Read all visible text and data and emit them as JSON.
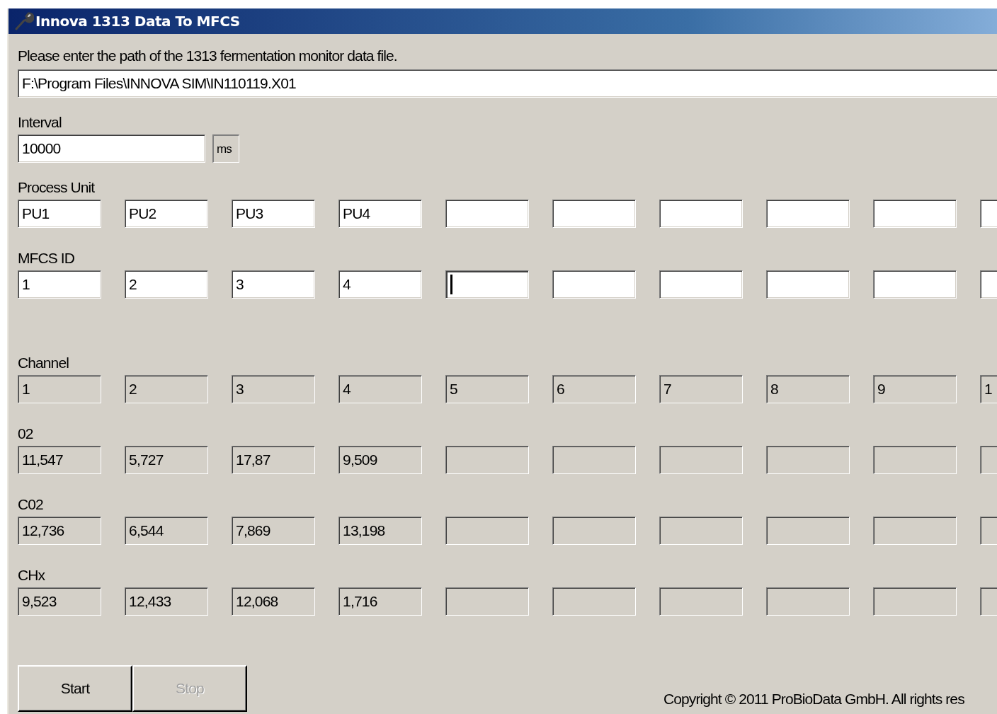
{
  "window": {
    "title": "Innova 1313 Data To MFCS"
  },
  "path": {
    "label": "Please enter the path of the 1313 fermentation monitor data file.",
    "value": "F:\\Program Files\\INNOVA SIM\\IN110119.X01"
  },
  "interval": {
    "label": "Interval",
    "value": "10000",
    "unit": "ms"
  },
  "groups": [
    {
      "rows": [
        {
          "label": "Process Unit",
          "readonly": false,
          "cells": [
            {
              "value": "PU1",
              "focused": false
            },
            {
              "value": "PU2",
              "focused": false
            },
            {
              "value": "PU3",
              "focused": false
            },
            {
              "value": "PU4",
              "focused": false
            },
            {
              "focused": false
            },
            {
              "focused": false
            },
            {
              "focused": false
            },
            {
              "focused": false
            },
            {
              "focused": false
            },
            {
              "focused": false
            }
          ]
        },
        {
          "label": "MFCS ID",
          "readonly": false,
          "cells": [
            {
              "value": "1",
              "focused": false
            },
            {
              "value": "2",
              "focused": false
            },
            {
              "value": "3",
              "focused": false
            },
            {
              "value": "4",
              "focused": false
            },
            {
              "focused": true
            },
            {
              "focused": false
            },
            {
              "focused": false
            },
            {
              "focused": false
            },
            {
              "focused": false
            },
            {
              "focused": false
            }
          ]
        }
      ]
    },
    {
      "rows": [
        {
          "label": "Channel",
          "readonly": true,
          "cells": [
            {
              "value": "1",
              "focused": false
            },
            {
              "value": "2",
              "focused": false
            },
            {
              "value": "3",
              "focused": false
            },
            {
              "value": "4",
              "focused": false
            },
            {
              "value": "5",
              "focused": false
            },
            {
              "value": "6",
              "focused": false
            },
            {
              "value": "7",
              "focused": false
            },
            {
              "value": "8",
              "focused": false
            },
            {
              "value": "9",
              "focused": false
            },
            {
              "value": "1",
              "focused": false
            }
          ]
        },
        {
          "label": "02",
          "readonly": true,
          "cells": [
            {
              "value": "11,547",
              "focused": false
            },
            {
              "value": "5,727",
              "focused": false
            },
            {
              "value": "17,87",
              "focused": false
            },
            {
              "value": "9,509",
              "focused": false
            },
            {
              "focused": false
            },
            {
              "focused": false
            },
            {
              "focused": false
            },
            {
              "focused": false
            },
            {
              "focused": false
            },
            {
              "focused": false
            }
          ]
        },
        {
          "label": "C02",
          "readonly": true,
          "cells": [
            {
              "value": "12,736",
              "focused": false
            },
            {
              "value": "6,544",
              "focused": false
            },
            {
              "value": "7,869",
              "focused": false
            },
            {
              "value": "13,198",
              "focused": false
            },
            {
              "focused": false
            },
            {
              "focused": false
            },
            {
              "focused": false
            },
            {
              "focused": false
            },
            {
              "focused": false
            },
            {
              "focused": false
            }
          ]
        },
        {
          "label": "CHx",
          "readonly": true,
          "cells": [
            {
              "value": "9,523",
              "focused": false
            },
            {
              "value": "12,433",
              "focused": false
            },
            {
              "value": "12,068",
              "focused": false
            },
            {
              "value": "1,716",
              "focused": false
            },
            {
              "focused": false
            },
            {
              "focused": false
            },
            {
              "focused": false
            },
            {
              "focused": false
            },
            {
              "focused": false
            },
            {
              "focused": false
            }
          ]
        }
      ]
    }
  ],
  "buttons": [
    {
      "label": "Start",
      "disabled": false
    },
    {
      "label": "Stop",
      "disabled": true
    }
  ],
  "copyright": "Copyright © 2011 ProBioData GmbH. All rights res"
}
